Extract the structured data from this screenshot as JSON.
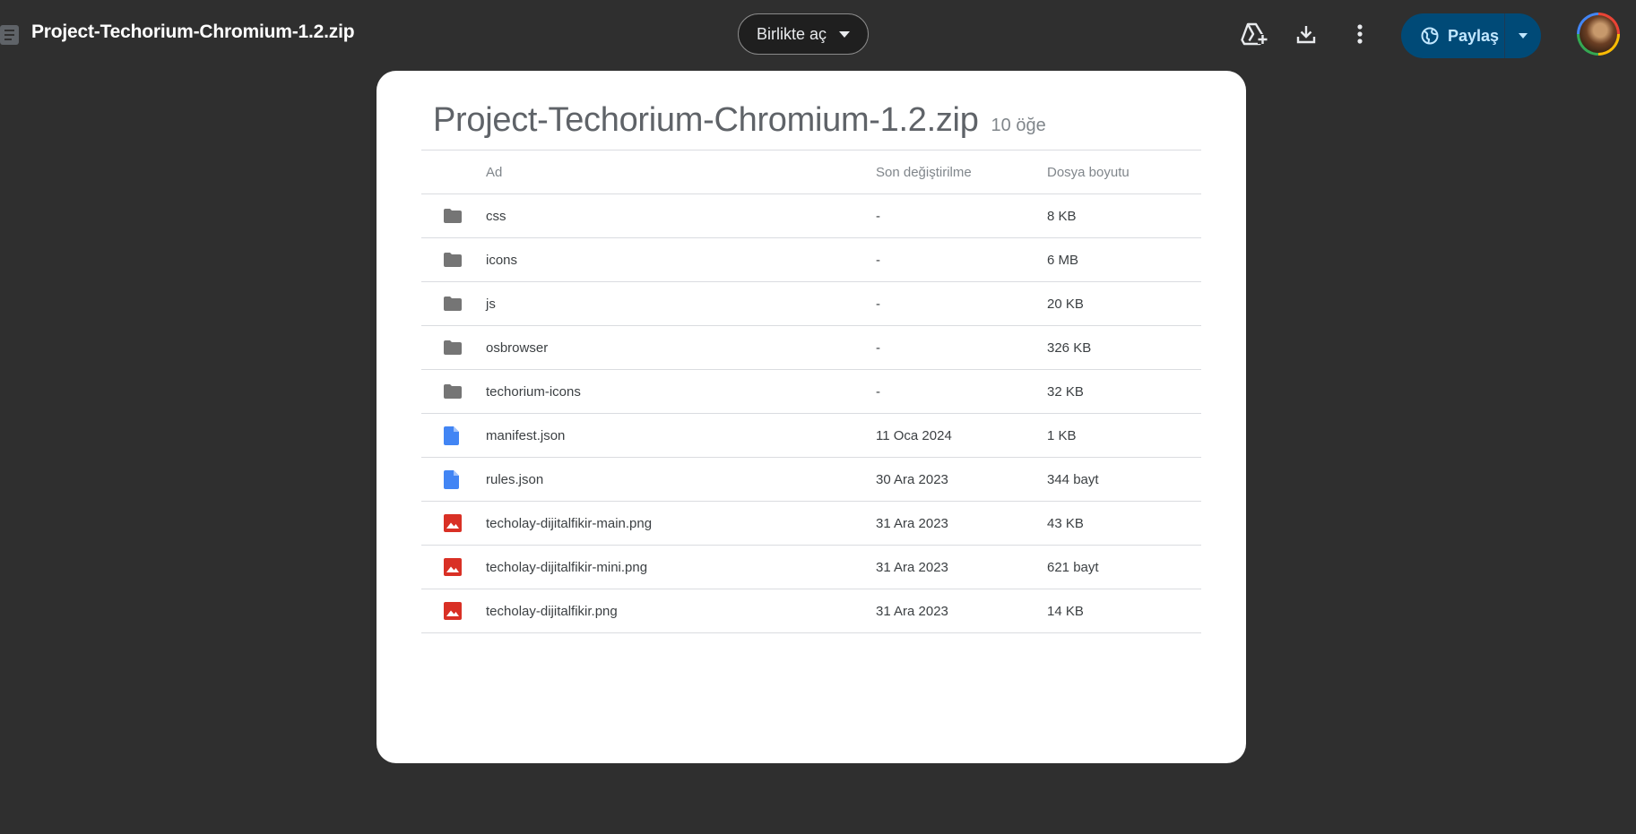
{
  "topbar": {
    "file_name": "Project-Techorium-Chromium-1.2.zip",
    "open_with_label": "Birlikte aç",
    "share_label": "Paylaş",
    "icons": [
      "zip-file-icon",
      "add-to-drive-icon",
      "download-icon",
      "more-options-icon",
      "globe-icon",
      "chevron-down-icon",
      "avatar"
    ]
  },
  "viewer": {
    "title": "Project-Techorium-Chromium-1.2.zip",
    "item_count": "10 öğe",
    "columns": {
      "name": "Ad",
      "modified": "Son değiştirilme",
      "size": "Dosya boyutu"
    },
    "rows": [
      {
        "type": "folder",
        "name": "css",
        "modified": "-",
        "size": "8 KB"
      },
      {
        "type": "folder",
        "name": "icons",
        "modified": "-",
        "size": "6 MB"
      },
      {
        "type": "folder",
        "name": "js",
        "modified": "-",
        "size": "20 KB"
      },
      {
        "type": "folder",
        "name": "osbrowser",
        "modified": "-",
        "size": "326 KB"
      },
      {
        "type": "folder",
        "name": "techorium-icons",
        "modified": "-",
        "size": "32 KB"
      },
      {
        "type": "document",
        "name": "manifest.json",
        "modified": "11 Oca 2024",
        "size": "1 KB"
      },
      {
        "type": "document",
        "name": "rules.json",
        "modified": "30 Ara 2023",
        "size": "344 bayt"
      },
      {
        "type": "image",
        "name": "techolay-dijitalfikir-main.png",
        "modified": "31 Ara 2023",
        "size": "43 KB"
      },
      {
        "type": "image",
        "name": "techolay-dijitalfikir-mini.png",
        "modified": "31 Ara 2023",
        "size": "621 bayt"
      },
      {
        "type": "image",
        "name": "techolay-dijitalfikir.png",
        "modified": "31 Ara 2023",
        "size": "14 KB"
      }
    ]
  },
  "colors": {
    "background": "#2f2f2f",
    "share_button": "#004a77",
    "share_text": "#c2e7ff",
    "folder_icon": "#757575",
    "document_icon": "#4285f4",
    "image_icon": "#d93025"
  }
}
